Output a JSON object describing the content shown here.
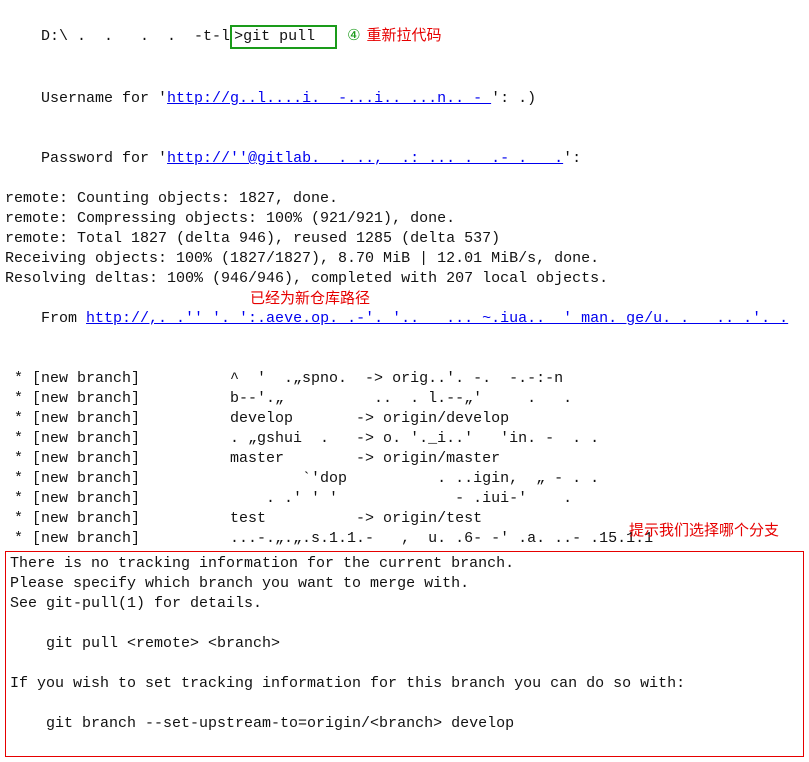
{
  "line1_prefix": "D:\\ ",
  "line1_obsc": ".  .   .  .  -t-l",
  "line1_cmd": ">git pull  ",
  "circle": "④",
  "annot_pull": "重新拉代码",
  "user_label": "Username for '",
  "user_url": "http://g..l....i.  -...i.. ...n.. - ",
  "user_tail": "': .)",
  "pass_label": "Password for '",
  "pass_url": "http://''@gitlab.  . ..,  .: ... .  .- .   .",
  "pass_tail": "':",
  "r1": "remote: Counting objects: 1827, done.",
  "r2": "remote: Compressing objects: 100% (921/921), done.",
  "r3": "remote: Total 1827 (delta 946), reused 1285 (delta 537)",
  "r4": "Receiving objects: 100% (1827/1827), 8.70 MiB | 12.01 MiB/s, done.",
  "r5": "Resolving deltas: 100% (946/946), completed with 207 local objects.",
  "from_label": "From ",
  "from_url": "http://,. .'' '. ':.aeve.op. .-'. '..   ... ~.iua..  ' man. ge/u. .   .. .'. .",
  "overlay_repo": "已经为新仓库路径",
  "branches": [
    " * [new branch]          ^  '  .„spno.  -> orig..'. -.  -.-:-n",
    " * [new branch]          b--'.„          ..  . l.--„'     .   .",
    " * [new branch]          develop       -> origin/develop",
    " * [new branch]          . „gshui  .   -> o. '._i..'   'in. -  . .",
    " * [new branch]          master        -> origin/master",
    " * [new branch]                  `'dop          . ..igin,  „ - . .",
    " * [new branch]              . .' ' '             - .iui-'    .",
    " * [new branch]          test          -> origin/test",
    " * [new branch]          ...-.„.„.s.1.1.-   ,  u. .6- -' .a. ..- .15.1.1"
  ],
  "annot_branch": "提示我们选择哪个分支",
  "box1": "There is no tracking information for the current branch.",
  "box2": "Please specify which branch you want to merge with.",
  "box3": "See git-pull(1) for details.",
  "box4": "    git pull <remote> <branch>",
  "box5": "If you wish to set tracking information for this branch you can do so with:",
  "box6": "    git branch --set-upstream-to=origin/<branch> develop"
}
